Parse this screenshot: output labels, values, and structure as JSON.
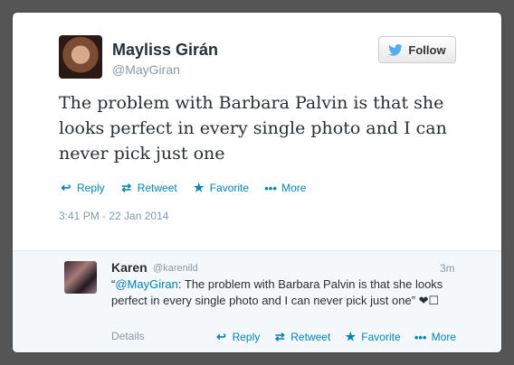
{
  "tweet": {
    "name": "Mayliss Girán",
    "handle": "@MayGiran",
    "follow_label": "Follow",
    "text": "The problem with Barbara Palvin is that she looks perfect in every single photo and I can never pick just one",
    "actions": {
      "reply": "Reply",
      "retweet": "Retweet",
      "favorite": "Favorite",
      "more": "More"
    },
    "timestamp": "3:41 PM - 22 Jan 2014"
  },
  "reply_tweet": {
    "name": "Karen",
    "handle": "@karenild",
    "time": "3m",
    "quote_open": "“",
    "mention": "@MayGiran",
    "text_rest": ": The problem with Barbara Palvin is that she looks perfect in every single photo and I can never pick just one” ❤︎☐",
    "details": "Details",
    "actions": {
      "reply": "Reply",
      "retweet": "Retweet",
      "favorite": "Favorite",
      "more": "More"
    }
  },
  "colors": {
    "link": "#0084b4",
    "muted": "#8899a6",
    "text": "#292f33",
    "background": "#555555"
  },
  "icons": [
    "twitter-bird-icon",
    "reply-icon",
    "retweet-icon",
    "favorite-star-icon",
    "more-dots-icon"
  ]
}
